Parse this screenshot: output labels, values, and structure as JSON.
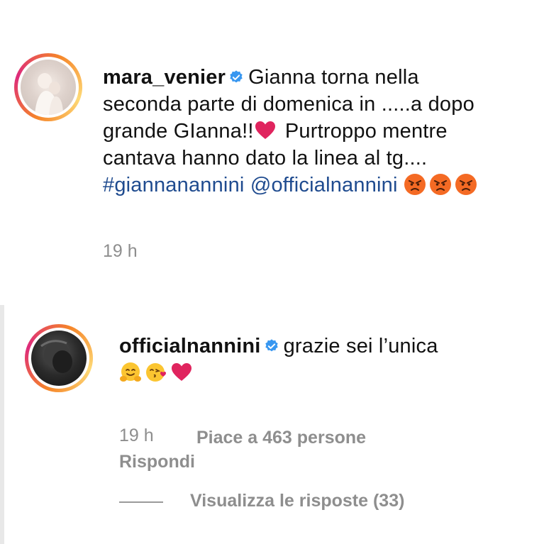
{
  "comments": [
    {
      "username": "mara_venier",
      "verified": true,
      "text_line1": "Gianna torna nella",
      "text_line2": "seconda parte di domenica in .....a dopo",
      "text_line3_a": "grande GIanna!!",
      "text_line3_b": " Purtroppo mentre",
      "text_line4": "cantava hanno dato la linea al tg....",
      "hashtag": "#giannanannini",
      "mention": "@officialnannini",
      "emojis": [
        "angry-face-icon",
        "angry-face-icon",
        "angry-face-icon"
      ],
      "time": "19 h"
    },
    {
      "username": "officialnannini",
      "verified": true,
      "text": "grazie sei l’unica",
      "emojis": [
        "hugging-face-icon",
        "face-blowing-kiss-icon",
        "red-heart-icon"
      ],
      "time": "19 h",
      "likes": "Piace a 463 persone",
      "reply": "Rispondi",
      "view_replies": "Visualizza le risposte (33)"
    }
  ],
  "colors": {
    "link": "#1f4b8f",
    "meta": "#8e8e8e",
    "verified": "#3897f0",
    "heart": "#e0245e"
  }
}
